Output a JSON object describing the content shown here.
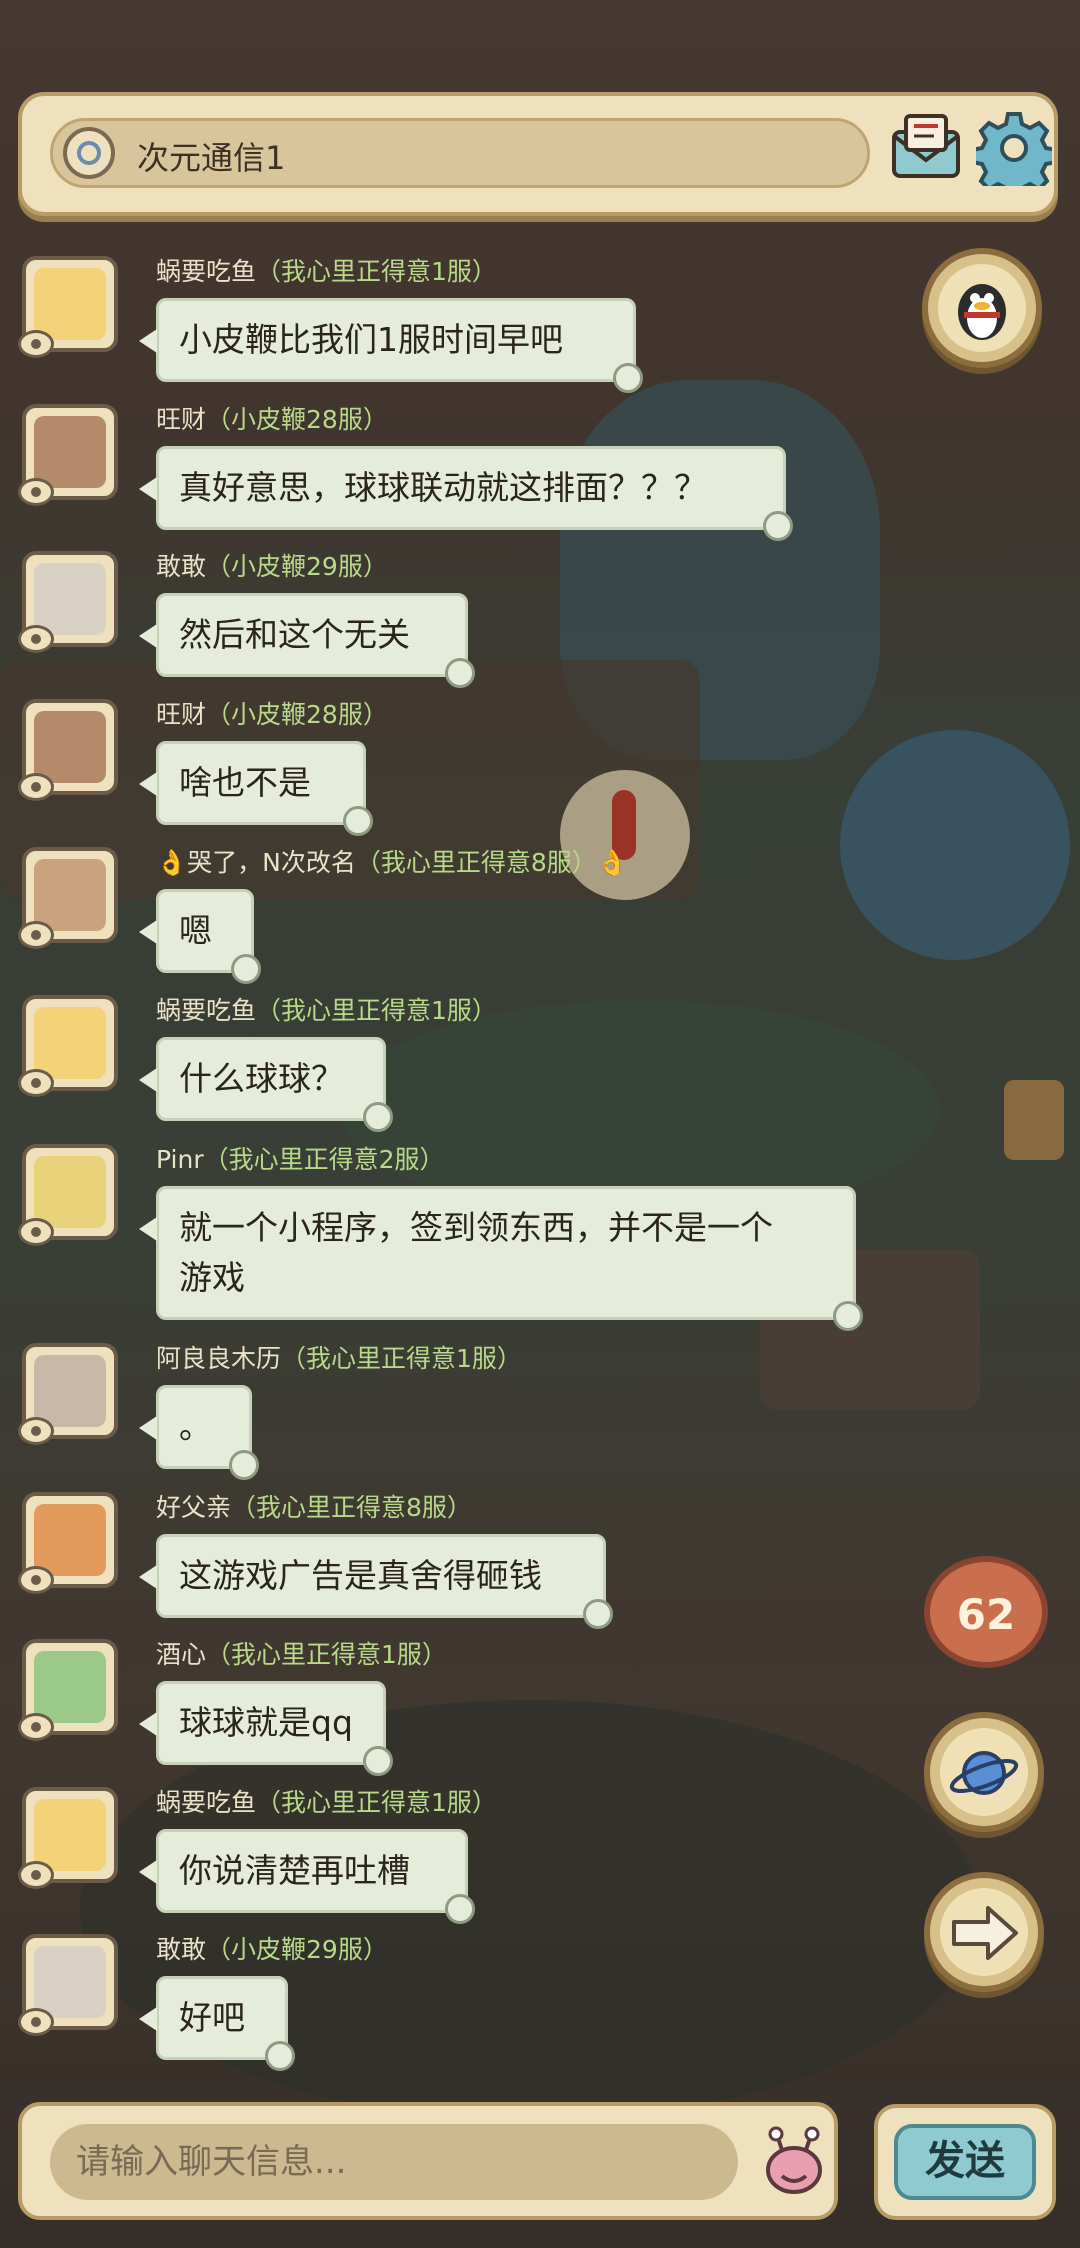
{
  "header": {
    "channel_name": "次元通信1"
  },
  "messages": [
    {
      "sender": "蜗要吃鱼",
      "server": "（我心里正得意1服）",
      "text": "小皮鞭比我们1服时间早吧"
    },
    {
      "sender": "旺财",
      "server": "（小皮鞭28服）",
      "text": "真好意思，球球联动就这排面？？？"
    },
    {
      "sender": "敢敢",
      "server": "（小皮鞭29服）",
      "text": "然后和这个无关"
    },
    {
      "sender": "旺财",
      "server": "（小皮鞭28服）",
      "text": "啥也不是"
    },
    {
      "sender": "👌哭了，N次改名",
      "server": "（我心里正得意8服）👌",
      "text": "嗯"
    },
    {
      "sender": "蜗要吃鱼",
      "server": "（我心里正得意1服）",
      "text": "什么球球？"
    },
    {
      "sender": "Pinr",
      "server": "（我心里正得意2服）",
      "text": "就一个小程序，签到领东西，并不是一个\n游戏"
    },
    {
      "sender": "阿良良木历",
      "server": "（我心里正得意1服）",
      "text": "。"
    },
    {
      "sender": "好父亲",
      "server": "（我心里正得意8服）",
      "text": "这游戏广告是真舍得砸钱"
    },
    {
      "sender": "酒心",
      "server": "（我心里正得意1服）",
      "text": "球球就是qq"
    },
    {
      "sender": "蜗要吃鱼",
      "server": "（我心里正得意1服）",
      "text": "你说清楚再吐槽"
    },
    {
      "sender": "敢敢",
      "server": "（小皮鞭29服）",
      "text": "好吧"
    }
  ],
  "side": {
    "unread_count": "62"
  },
  "footer": {
    "input_placeholder": "请输入聊天信息...",
    "send_label": "发送"
  },
  "colors": {
    "bubble": "#e5ecd9",
    "panel": "#efe1bd",
    "send": "#8ecad0",
    "server_text": "#b8d88a"
  },
  "icons": [
    "channel-icon",
    "mail-icon",
    "gear-icon",
    "penguin-icon",
    "planet-icon",
    "arrow-right-icon",
    "emoji-bug-icon",
    "eye-icon"
  ]
}
